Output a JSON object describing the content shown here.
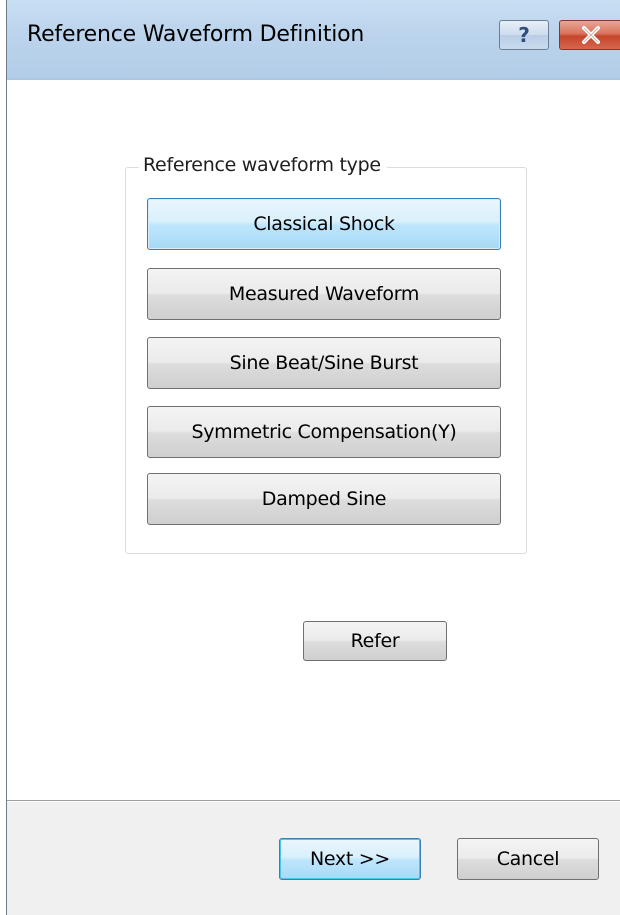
{
  "window": {
    "title": "Reference Waveform Definition",
    "help_glyph": "?",
    "icons": {
      "help": "question-mark-icon",
      "close": "close-icon"
    },
    "colors": {
      "title_bar": "#bcd4ec",
      "close_button": "#c4452a",
      "selected_button": "#bee6fd"
    }
  },
  "group": {
    "label": "Reference waveform type",
    "buttons": [
      {
        "label": "Classical Shock",
        "selected": true
      },
      {
        "label": "Measured Waveform",
        "selected": false
      },
      {
        "label": "Sine Beat/Sine Burst",
        "selected": false
      },
      {
        "label": "Symmetric Compensation(Y)",
        "selected": false
      },
      {
        "label": "Damped Sine",
        "selected": false
      }
    ]
  },
  "refer_button": {
    "label": "Refer"
  },
  "footer": {
    "next_label": "Next >>",
    "cancel_label": "Cancel"
  }
}
